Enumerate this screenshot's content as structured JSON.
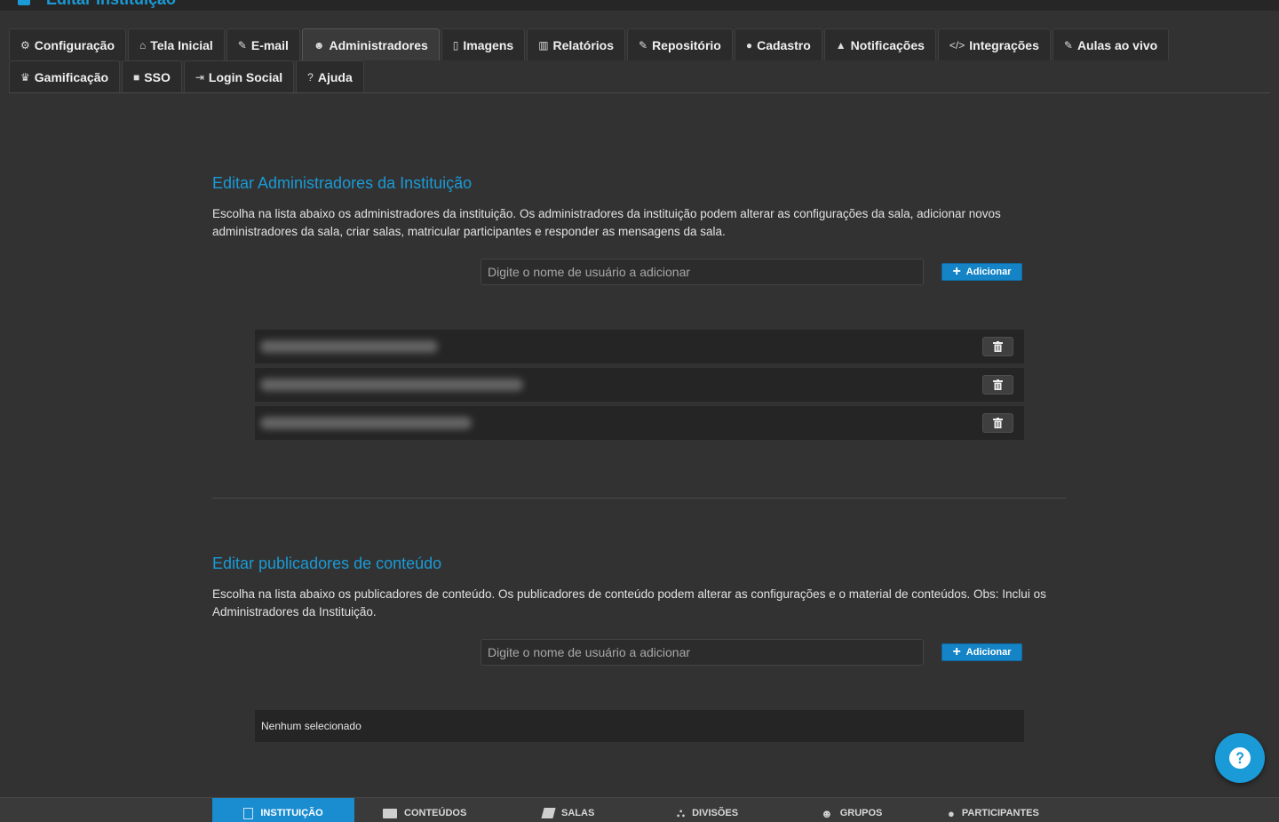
{
  "page": {
    "title": "Editar Instituição"
  },
  "tabs_row1": [
    {
      "label": "Configuração",
      "icon": "⚙",
      "name": "tab-configuracao",
      "active": false
    },
    {
      "label": "Tela Inicial",
      "icon": "🏠",
      "name": "tab-tela-inicial",
      "active": false
    },
    {
      "label": "E-mail",
      "icon": "✎",
      "name": "tab-email",
      "active": false
    },
    {
      "label": "Administradores",
      "icon": "👥",
      "name": "tab-administradores",
      "active": true
    },
    {
      "label": "Imagens",
      "icon": "🗋",
      "name": "tab-imagens",
      "active": false
    },
    {
      "label": "Relatórios",
      "icon": "📊",
      "name": "tab-relatorios",
      "active": false
    },
    {
      "label": "Repositório",
      "icon": "✎",
      "name": "tab-repositorio",
      "active": false
    },
    {
      "label": "Cadastro",
      "icon": "👤",
      "name": "tab-cadastro",
      "active": false
    },
    {
      "label": "Notificações",
      "icon": "🔔",
      "name": "tab-notificacoes",
      "active": false
    },
    {
      "label": "Integrações",
      "icon": "</>",
      "name": "tab-integracoes",
      "active": false
    },
    {
      "label": "Aulas ao vivo",
      "icon": "✎",
      "name": "tab-aulas-ao-vivo",
      "active": false
    }
  ],
  "tabs_row2": [
    {
      "label": "Gamificação",
      "icon": "🏆",
      "name": "tab-gamificacao",
      "active": false
    },
    {
      "label": "SSO",
      "icon": "🔒",
      "name": "tab-sso",
      "active": false
    },
    {
      "label": "Login Social",
      "icon": "⇥",
      "name": "tab-login-social",
      "active": false
    },
    {
      "label": "Ajuda",
      "icon": "?",
      "name": "tab-ajuda",
      "active": false
    }
  ],
  "admins": {
    "title": "Editar Administradores da Instituição",
    "description": "Escolha na lista abaixo os administradores da instituição. Os administradores da instituição podem alterar as configurações da sala, adicionar novos administradores da sala, criar salas, matricular participantes e responder as mensagens da sala.",
    "input_placeholder": "Digite o nome de usuário a adicionar",
    "add_label": "Adicionar"
  },
  "publishers": {
    "title": "Editar publicadores de conteúdo",
    "description": "Escolha na lista abaixo os publicadores de conteúdo. Os publicadores de conteúdo podem alterar as configurações e o material de conteúdos. Obs: Inclui os Administradores da Instituição.",
    "input_placeholder": "Digite o nome de usuário a adicionar",
    "add_label": "Adicionar",
    "empty_text": "Nenhum selecionado"
  },
  "bottom_nav": [
    {
      "label": "INSTITUIÇÃO",
      "name": "nav-instituicao",
      "active": true
    },
    {
      "label": "CONTEÚDOS",
      "name": "nav-conteudos",
      "active": false
    },
    {
      "label": "SALAS",
      "name": "nav-salas",
      "active": false
    },
    {
      "label": "DIVISÕES",
      "name": "nav-divisoes",
      "active": false
    },
    {
      "label": "GRUPOS",
      "name": "nav-grupos",
      "active": false
    },
    {
      "label": "PARTICIPANTES",
      "name": "nav-participantes",
      "active": false
    }
  ],
  "colors": {
    "accent": "#1a9ad6",
    "button": "#1484c6",
    "background": "#323232"
  }
}
